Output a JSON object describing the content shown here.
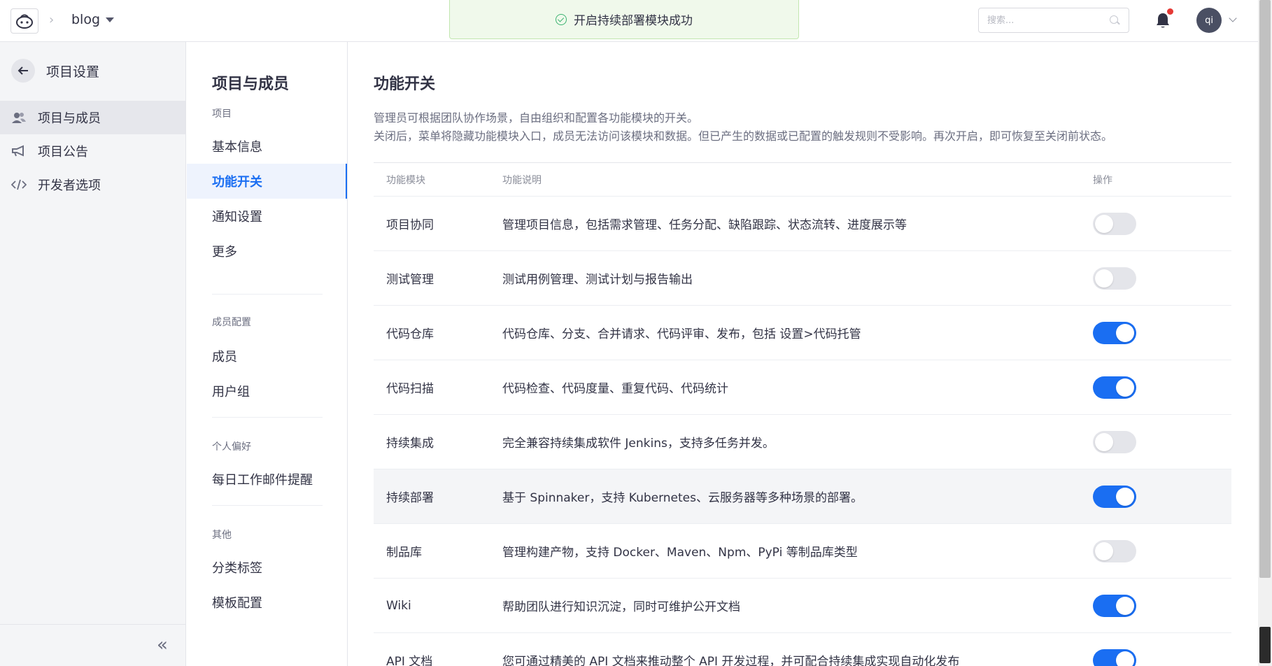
{
  "header": {
    "project": "blog",
    "toast": "开启持续部署模块成功",
    "search_placeholder": "搜索...",
    "avatar": "qi"
  },
  "sidebar": {
    "title": "项目设置",
    "items": [
      {
        "label": "项目与成员",
        "icon": "members-icon",
        "active": true
      },
      {
        "label": "项目公告",
        "icon": "megaphone-icon",
        "active": false
      },
      {
        "label": "开发者选项",
        "icon": "code-icon",
        "active": false
      }
    ]
  },
  "subnav": {
    "title": "项目与成员",
    "groups": [
      {
        "label": "项目",
        "items": [
          "基本信息",
          "功能开关",
          "通知设置",
          "更多"
        ]
      },
      {
        "label": "成员配置",
        "items": [
          "成员",
          "用户组"
        ]
      },
      {
        "label": "个人偏好",
        "items": [
          "每日工作邮件提醒"
        ]
      },
      {
        "label": "其他",
        "items": [
          "分类标签",
          "模板配置"
        ]
      }
    ],
    "active": "功能开关"
  },
  "main": {
    "title": "功能开关",
    "desc_line1": "管理员可根据团队协作场景，自由组织和配置各功能模块的开关。",
    "desc_line2": "关闭后，菜单将隐藏功能模块入口，成员无法访问该模块和数据。但已产生的数据或已配置的触发规则不受影响。再次开启，即可恢复至关闭前状态。",
    "columns": [
      "功能模块",
      "功能说明",
      "操作"
    ],
    "rows": [
      {
        "name": "项目协同",
        "desc": "管理项目信息，包括需求管理、任务分配、缺陷跟踪、状态流转、进度展示等",
        "on": false
      },
      {
        "name": "测试管理",
        "desc": "测试用例管理、测试计划与报告输出",
        "on": false
      },
      {
        "name": "代码仓库",
        "desc": "代码仓库、分支、合并请求、代码评审、发布，包括 设置>代码托管",
        "on": true
      },
      {
        "name": "代码扫描",
        "desc": "代码检查、代码度量、重复代码、代码统计",
        "on": true
      },
      {
        "name": "持续集成",
        "desc": "完全兼容持续集成软件 Jenkins，支持多任务并发。",
        "on": false
      },
      {
        "name": "持续部署",
        "desc": "基于 Spinnaker，支持 Kubernetes、云服务器等多种场景的部署。",
        "on": true
      },
      {
        "name": "制品库",
        "desc": "管理构建产物，支持 Docker、Maven、Npm、PyPi 等制品库类型",
        "on": false
      },
      {
        "name": "Wiki",
        "desc": "帮助团队进行知识沉淀，同时可维护公开文档",
        "on": true
      },
      {
        "name": "API 文档",
        "desc": "您可通过精美的 API 文档来推动整个 API 开发过程，并可配合持续集成实现自动化发布",
        "on": true
      }
    ]
  }
}
